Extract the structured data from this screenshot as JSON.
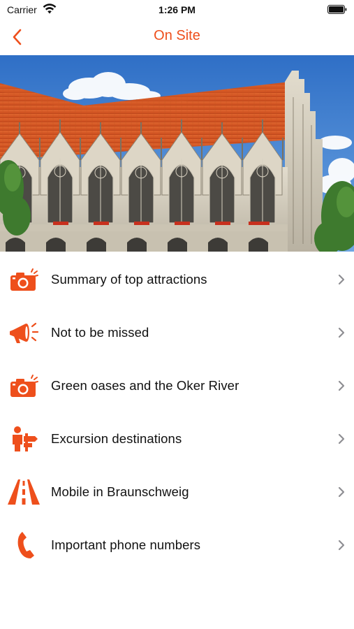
{
  "status_bar": {
    "carrier": "Carrier",
    "time": "1:26 PM"
  },
  "nav": {
    "title": "On Site",
    "back_icon": "chevron-left-icon"
  },
  "hero": {
    "subject": "Gothic town hall with arcades and red tiled roof"
  },
  "colors": {
    "accent": "#ee4f1c",
    "chevron": "#8e8e93"
  },
  "menu": {
    "items": [
      {
        "label": "Summary of top attractions",
        "icon": "camera-icon"
      },
      {
        "label": "Not to be missed",
        "icon": "megaphone-icon"
      },
      {
        "label": "Green oases and the Oker River",
        "icon": "camera-icon"
      },
      {
        "label": "Excursion destinations",
        "icon": "person-signpost-icon"
      },
      {
        "label": "Mobile in Braunschweig",
        "icon": "road-icon"
      },
      {
        "label": "Important phone numbers",
        "icon": "phone-icon"
      }
    ]
  }
}
